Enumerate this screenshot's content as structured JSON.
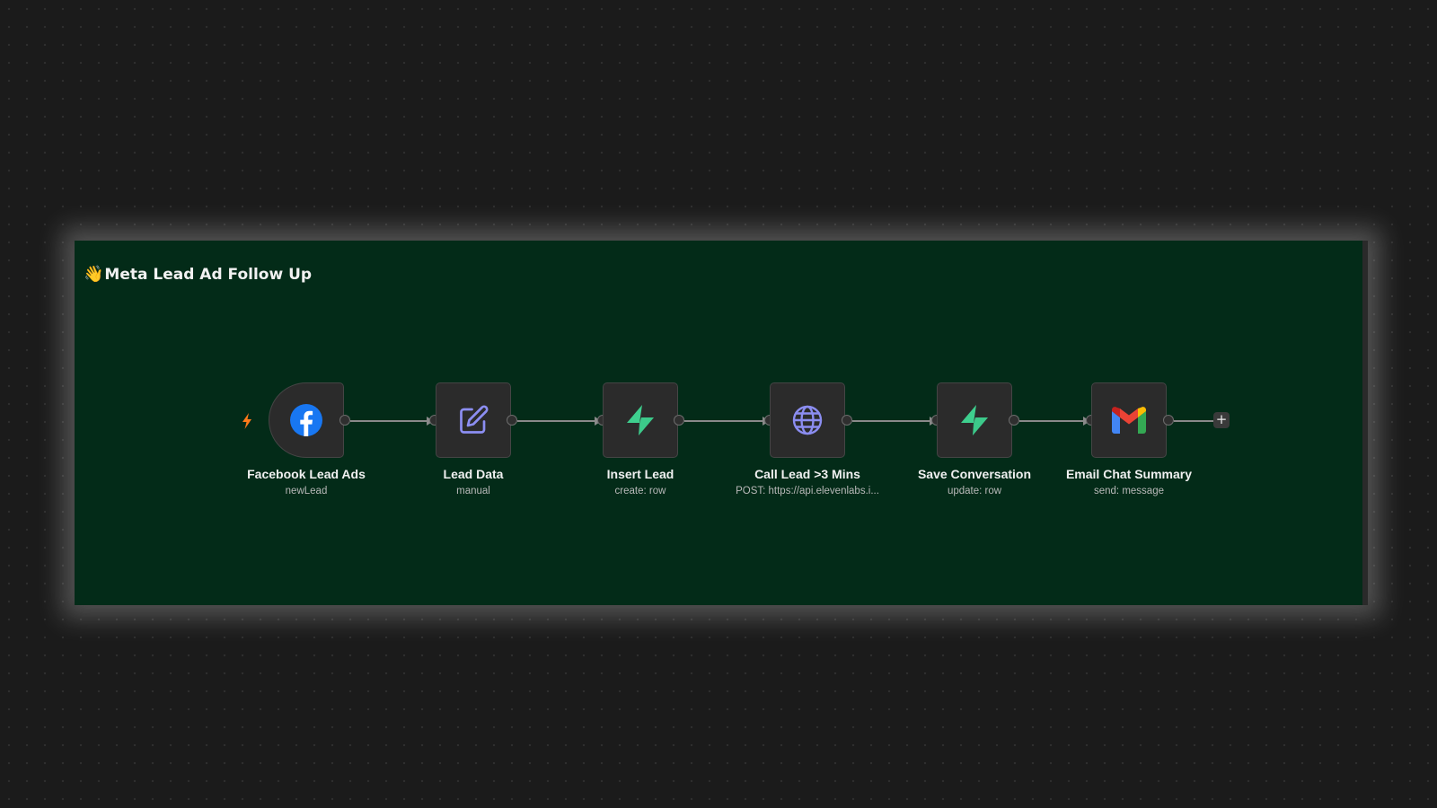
{
  "sticky": {
    "emoji": "👋",
    "title": "Meta Lead Ad Follow Up"
  },
  "workflow": {
    "nodes": [
      {
        "name": "Facebook Lead Ads",
        "subtitle": "newLead",
        "icon": "facebook-icon"
      },
      {
        "name": "Lead Data",
        "subtitle": "manual",
        "icon": "edit-icon"
      },
      {
        "name": "Insert Lead",
        "subtitle": "create: row",
        "icon": "supabase-icon"
      },
      {
        "name": "Call Lead >3 Mins",
        "subtitle": "POST: https://api.elevenlabs.i...",
        "icon": "globe-icon"
      },
      {
        "name": "Save Conversation",
        "subtitle": "update: row",
        "icon": "supabase-icon"
      },
      {
        "name": "Email Chat Summary",
        "subtitle": "send: message",
        "icon": "gmail-icon"
      }
    ],
    "add_button": "+"
  },
  "colors": {
    "canvas_bg": "#1b1b1b",
    "sticky_bg": "#032b18",
    "node_bg": "#2b2b2b",
    "facebook_blue": "#1877f2",
    "supabase_green": "#3ecf8e",
    "edit_purple": "#8c8ef2",
    "globe_purple": "#8b8df0",
    "trigger_orange": "#ff7a1a"
  }
}
